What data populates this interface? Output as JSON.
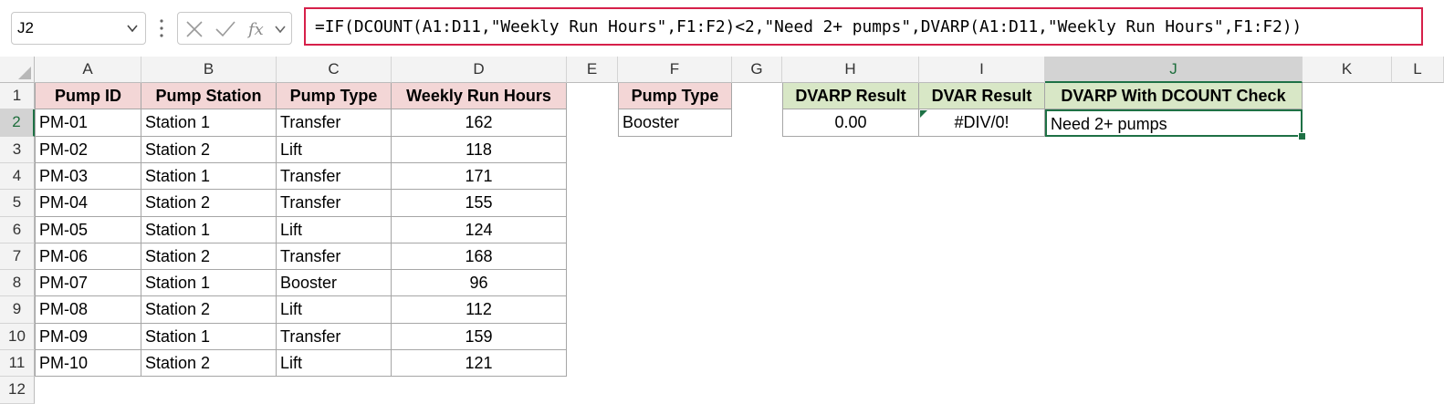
{
  "name_box": "J2",
  "formula": "=IF(DCOUNT(A1:D11,\"Weekly Run Hours\",F1:F2)<2,\"Need 2+ pumps\",DVARP(A1:D11,\"Weekly Run Hours\",F1:F2))",
  "columns": [
    "A",
    "B",
    "C",
    "D",
    "E",
    "F",
    "G",
    "H",
    "I",
    "J",
    "K",
    "L"
  ],
  "selected_column": "J",
  "rows": [
    "1",
    "2",
    "3",
    "4",
    "5",
    "6",
    "7",
    "8",
    "9",
    "10",
    "11",
    "12"
  ],
  "selected_row": "2",
  "headers": [
    "Pump ID",
    "Pump Station",
    "Pump Type",
    "Weekly Run Hours"
  ],
  "table": [
    [
      "PM-01",
      "Station 1",
      "Transfer",
      "162"
    ],
    [
      "PM-02",
      "Station 2",
      "Lift",
      "118"
    ],
    [
      "PM-03",
      "Station 1",
      "Transfer",
      "171"
    ],
    [
      "PM-04",
      "Station 2",
      "Transfer",
      "155"
    ],
    [
      "PM-05",
      "Station 1",
      "Lift",
      "124"
    ],
    [
      "PM-06",
      "Station 2",
      "Transfer",
      "168"
    ],
    [
      "PM-07",
      "Station 1",
      "Booster",
      "96"
    ],
    [
      "PM-08",
      "Station 2",
      "Lift",
      "112"
    ],
    [
      "PM-09",
      "Station 1",
      "Transfer",
      "159"
    ],
    [
      "PM-10",
      "Station 2",
      "Lift",
      "121"
    ]
  ],
  "criteria": {
    "header": "Pump Type",
    "value": "Booster"
  },
  "results": {
    "headers": [
      "DVARP Result",
      "DVAR Result",
      "DVARP With DCOUNT Check"
    ],
    "values": [
      "0.00",
      "#DIV/0!",
      "Need 2+ pumps"
    ]
  },
  "colors": {
    "pink_header": "#f3d6d6",
    "green_header": "#d8e7c6",
    "selection": "#1e7145",
    "formula_border": "#d6204a"
  }
}
